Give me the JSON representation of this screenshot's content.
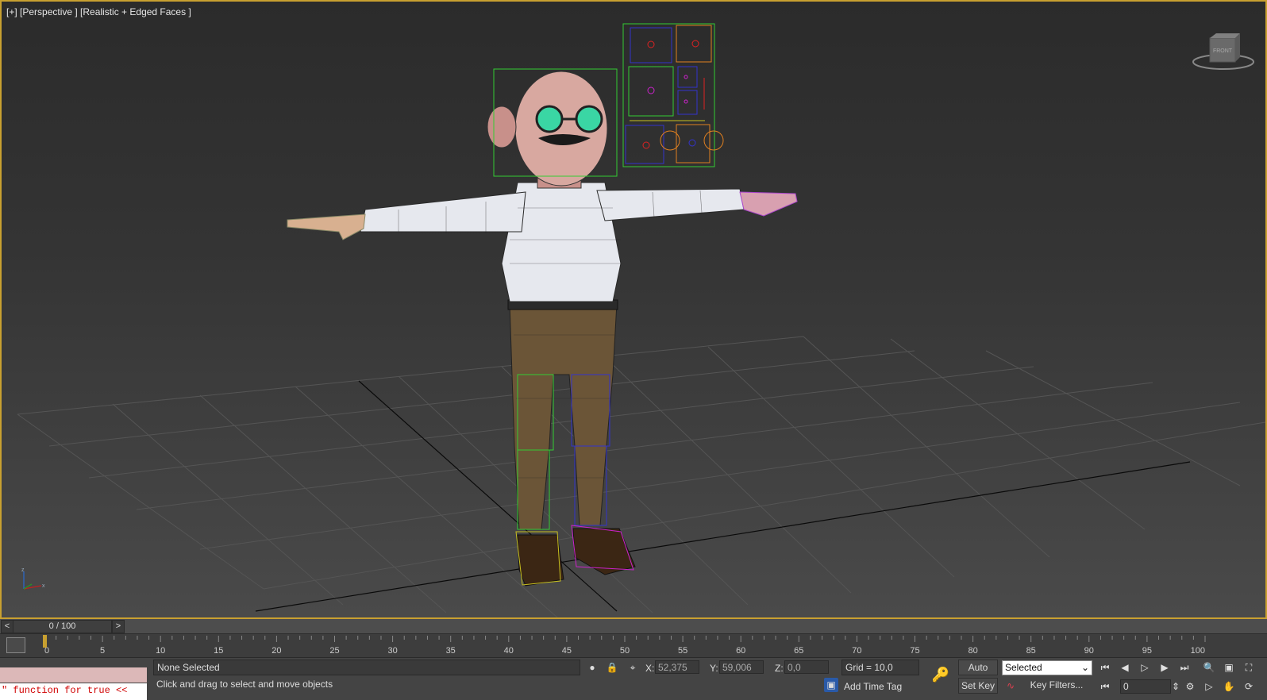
{
  "viewport": {
    "label": "[+] [Perspective ] [Realistic + Edged Faces ]",
    "viewcube_label": "FRONT"
  },
  "time_slider": {
    "prev": "<",
    "next": ">",
    "position": "0 / 100",
    "ticks": [
      "0",
      "5",
      "10",
      "15",
      "20",
      "25",
      "30",
      "35",
      "40",
      "45",
      "50",
      "55",
      "60",
      "65",
      "70",
      "75",
      "80",
      "85",
      "90",
      "95",
      "100"
    ]
  },
  "maxscript": {
    "output": "\" function for true <<"
  },
  "status": {
    "selection": "None Selected",
    "prompt": "Click and drag to select and move objects",
    "x_label": "X:",
    "x_value": "52,375",
    "y_label": "Y:",
    "y_value": "59,006",
    "z_label": "Z:",
    "z_value": "0,0",
    "grid": "Grid = 10,0",
    "add_time_tag": "Add Time Tag"
  },
  "animation": {
    "auto_key": "Auto Key",
    "set_key": "Set Key",
    "selected_option": "Selected",
    "key_filters": "Key Filters...",
    "current_frame": "0"
  },
  "colors": {
    "viewport_border": "#c8a030",
    "selection_box": "#33cc33",
    "rig_blue": "#3333cc",
    "rig_orange": "#e08020",
    "rig_red": "#dd2222"
  }
}
